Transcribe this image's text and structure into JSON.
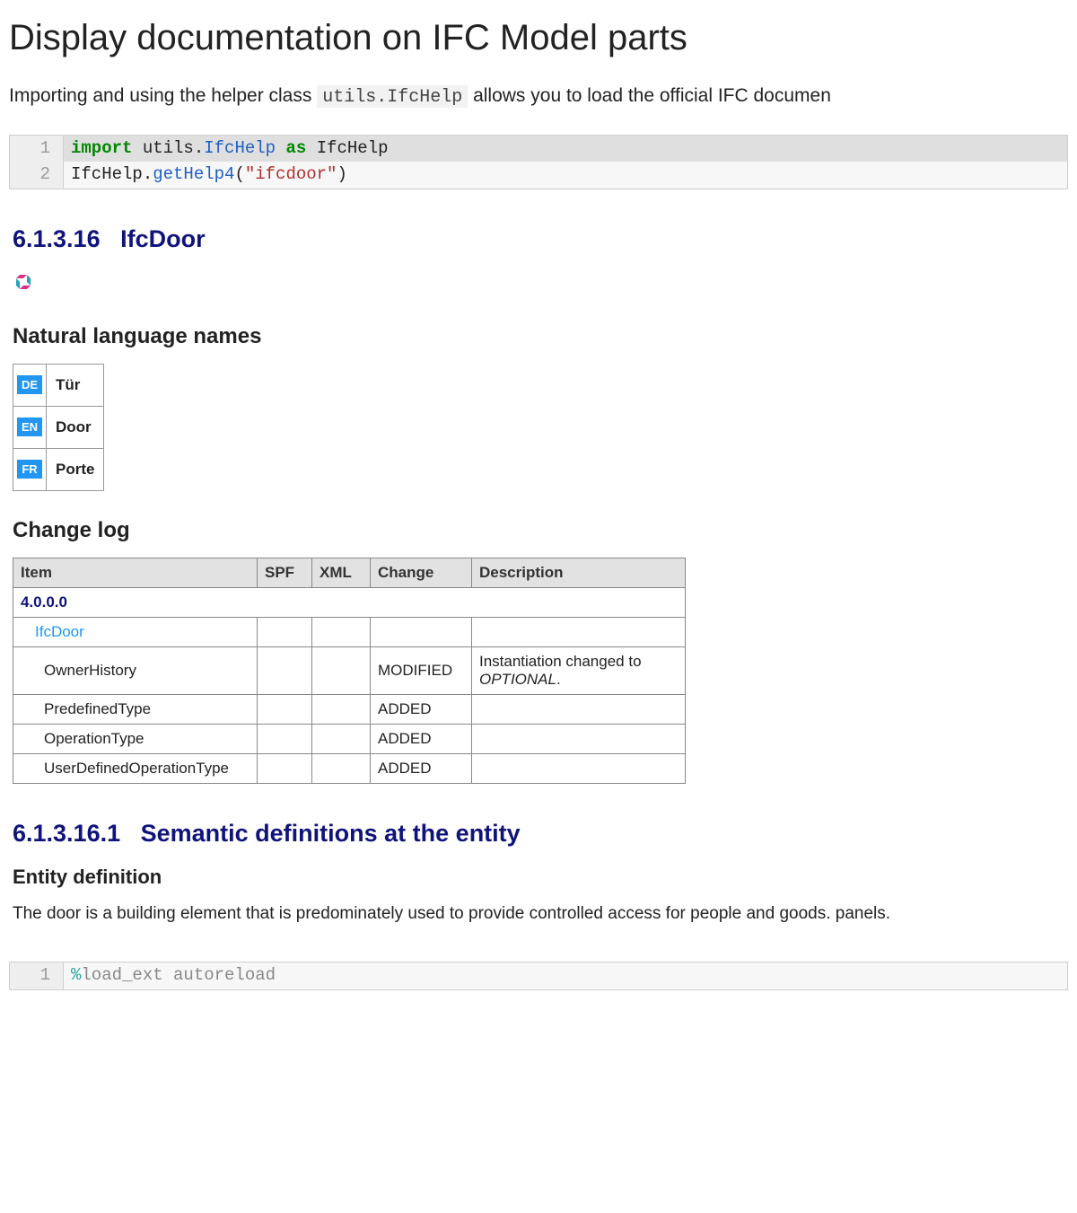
{
  "title": "Display documentation on IFC Model parts",
  "intro_prefix": "Importing and using the helper class ",
  "intro_code": "utils.IfcHelp",
  "intro_suffix": " allows you to load the official IFC documen",
  "code1": {
    "l1": {
      "kw1": "import",
      "mod": "utils.",
      "cls": "IfcHelp",
      "kw2": "as",
      "alias": "IfcHelp"
    },
    "l2": {
      "obj": "IfcHelp.",
      "fn": "getHelp4",
      "paren_open": "(",
      "str": "\"ifcdoor\"",
      "paren_close": ")"
    }
  },
  "doc": {
    "section_num": "6.1.3.16",
    "section_name": "IfcDoor",
    "nat_lang_head": "Natural language names",
    "languages": [
      {
        "code": "DE",
        "name": "Tür"
      },
      {
        "code": "EN",
        "name": "Door"
      },
      {
        "code": "FR",
        "name": "Porte"
      }
    ],
    "changelog_head": "Change log",
    "changelog": {
      "headers": [
        "Item",
        "SPF",
        "XML",
        "Change",
        "Description"
      ],
      "rows": [
        {
          "type": "version",
          "item": "4.0.0.0"
        },
        {
          "type": "link",
          "item": "IfcDoor",
          "spf": "",
          "xml": "",
          "change": "",
          "desc": ""
        },
        {
          "type": "attr",
          "item": "OwnerHistory",
          "spf": "",
          "xml": "",
          "change": "MODIFIED",
          "desc_pre": "Instantiation changed to ",
          "desc_em": "OPTIONAL",
          "desc_post": "."
        },
        {
          "type": "attr",
          "item": "PredefinedType",
          "spf": "",
          "xml": "",
          "change": "ADDED",
          "desc": ""
        },
        {
          "type": "attr",
          "item": "OperationType",
          "spf": "",
          "xml": "",
          "change": "ADDED",
          "desc": ""
        },
        {
          "type": "attr",
          "item": "UserDefinedOperationType",
          "spf": "",
          "xml": "",
          "change": "ADDED",
          "desc": ""
        }
      ]
    },
    "sem_section_num": "6.1.3.16.1",
    "sem_section_name": "Semantic definitions at the entity",
    "entity_def_head": "Entity definition",
    "entity_def_body": "The door is a building element that is predominately used to provide controlled access for people and goods. panels."
  },
  "code2": {
    "l1": {
      "magic": "%",
      "text": "load_ext autoreload"
    }
  }
}
